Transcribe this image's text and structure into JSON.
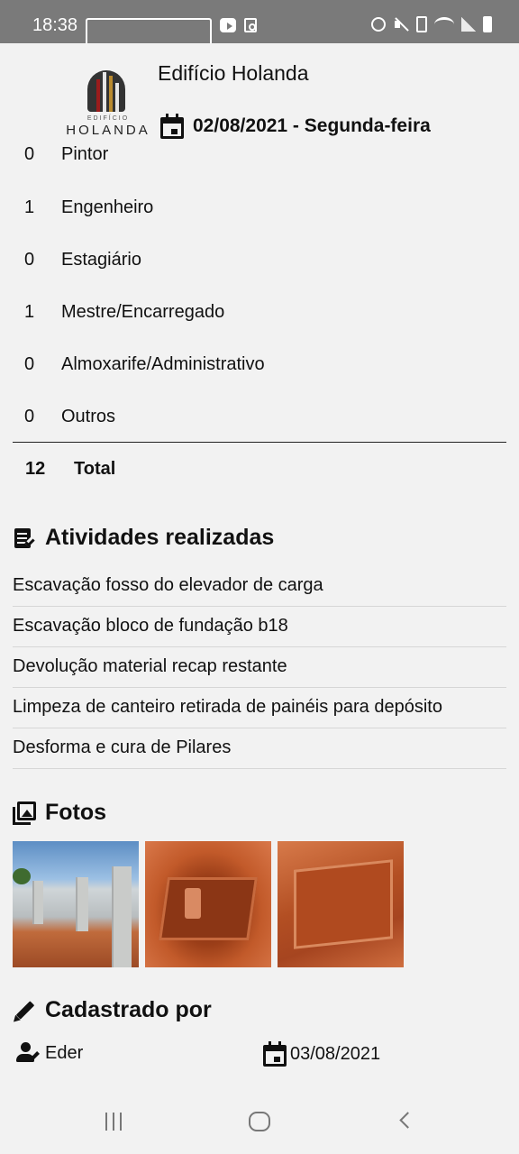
{
  "status_bar": {
    "time": "18:38"
  },
  "header": {
    "title": "Edifício Holanda",
    "date": "02/08/2021 - Segunda-feira",
    "logo": {
      "subtitle": "EDIFÍCIO",
      "name": "HOLANDA"
    }
  },
  "staff": {
    "partial_row": {
      "qty": "0",
      "role": "Pintor"
    },
    "rows": [
      {
        "qty": "1",
        "role": "Engenheiro"
      },
      {
        "qty": "0",
        "role": "Estagiário"
      },
      {
        "qty": "1",
        "role": "Mestre/Encarregado"
      },
      {
        "qty": "0",
        "role": "Almoxarife/Administrativo"
      },
      {
        "qty": "0",
        "role": "Outros"
      }
    ],
    "total": {
      "qty": "12",
      "label": "Total"
    }
  },
  "activities": {
    "title": "Atividades realizadas",
    "icon": "assignment-check-icon",
    "items": [
      "Escavação fosso do elevador de carga",
      "Escavação bloco de fundação b18",
      "Devolução material recap restante",
      "Limpeza de canteiro retirada de painéis para depósito",
      "Desforma e cura de Pilares"
    ]
  },
  "photos": {
    "title": "Fotos",
    "icon": "photo-library-icon",
    "count": 3
  },
  "registered": {
    "title": "Cadastrado por",
    "icon": "pencil-icon",
    "user": "Eder",
    "date": "03/08/2021"
  }
}
